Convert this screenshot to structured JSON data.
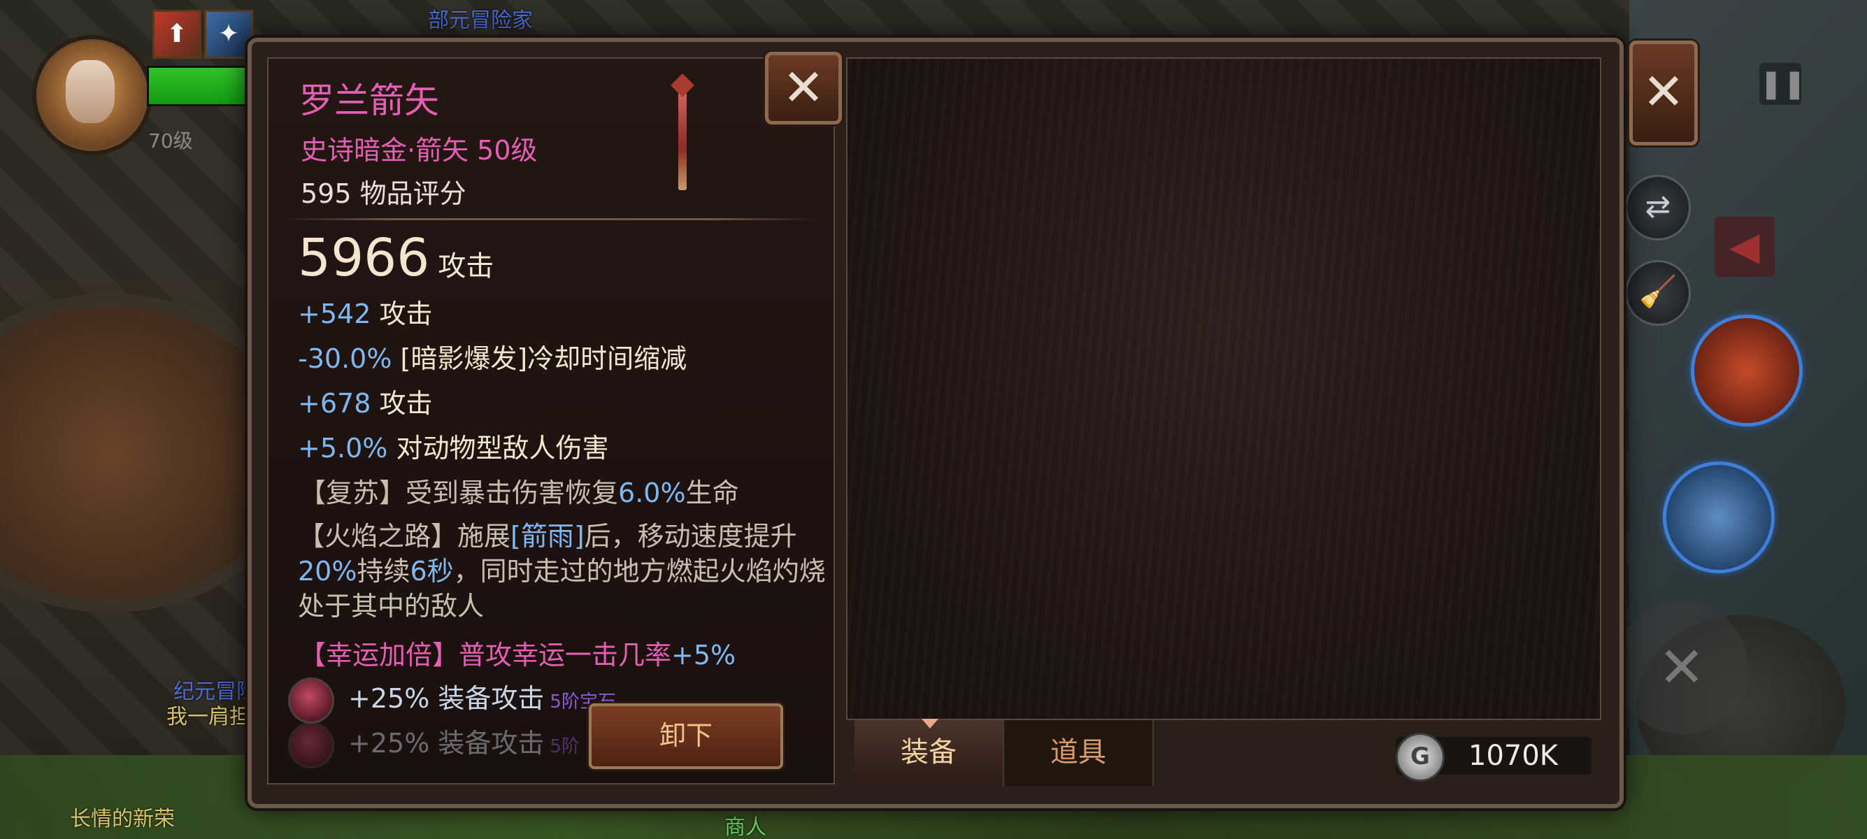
{
  "background": {
    "npc_labels": [
      {
        "text": "部元冒险家",
        "color": "blue"
      },
      {
        "text": "纪元冒险",
        "color": "blue"
      },
      {
        "text": "我一肩担",
        "color": "yellow"
      },
      {
        "text": "长情的新荣",
        "color": "yellow"
      },
      {
        "text": "商人",
        "color": "green"
      }
    ]
  },
  "player": {
    "level_text": "70级",
    "hp_fraction": 1.0,
    "buffs": [
      "armor-up-icon",
      "ice-shield-icon"
    ]
  },
  "item": {
    "name": "罗兰箭矢",
    "type": "史诗暗金·箭矢 50级",
    "score": "595 物品评分",
    "main_stat_value": "5966",
    "main_stat_label": "攻击",
    "stats": [
      {
        "value": "+542",
        "label": "攻击"
      },
      {
        "value": "-30.0%",
        "label": "[暗影爆发]冷却时间缩减"
      },
      {
        "value": "+678",
        "label": "攻击"
      },
      {
        "value": "+5.0%",
        "label": "对动物型敌人伤害"
      }
    ],
    "affix_revive": {
      "pre": "【复苏】受到暴击伤害恢复",
      "value": "6.0%",
      "post": "生命"
    },
    "affix_flame": {
      "p1": "【火焰之路】施展",
      "skill": "[箭雨]",
      "p2": "后，移动速度提升",
      "v1": "20%",
      "p3": "持续",
      "v2": "6秒",
      "p4": "，同时走过的地方燃起火焰灼烧处于其中的敌人"
    },
    "legend": {
      "pre": "【幸运加倍】普攻幸运一击几率",
      "value": "+5%"
    },
    "gems": [
      {
        "value": "+25%",
        "label": "装备攻击",
        "rank": "5阶宝石"
      },
      {
        "value": "+25%",
        "label": "装备攻击",
        "rank": "5阶"
      }
    ]
  },
  "buttons": {
    "unequip": "卸下",
    "close": "✕"
  },
  "tabs": {
    "equip": "装备",
    "items": "道具"
  },
  "currency": {
    "coin_symbol": "G",
    "amount": "1070K"
  },
  "side_controls": {
    "swap_icon": "⇄",
    "broom_icon": "🧹",
    "pause_icon": "❚❚",
    "arrow_icon": "◀",
    "joystick_icon": "✕"
  }
}
